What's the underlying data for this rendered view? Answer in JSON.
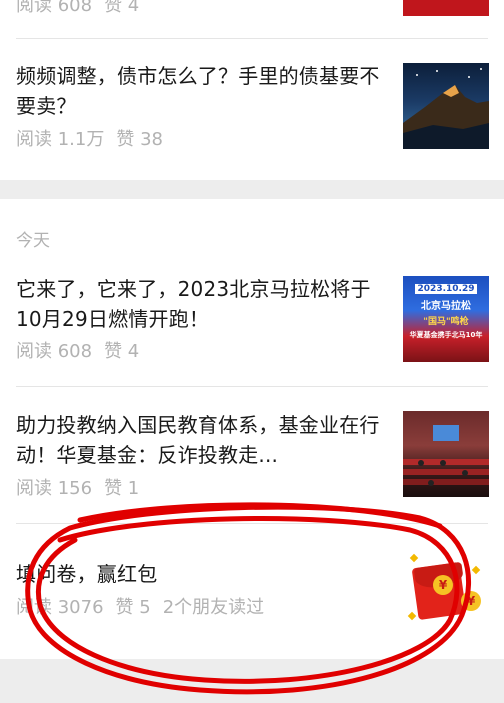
{
  "articles_prev": [
    {
      "title": "",
      "stats": {
        "reads": "阅读 608",
        "likes": "赞 4"
      }
    },
    {
      "title": "频频调整，债市怎么了？手里的债基要不要卖？",
      "stats": {
        "reads": "阅读 1.1万",
        "likes": "赞 38"
      }
    }
  ],
  "section_today": {
    "date_label": "今天",
    "articles": [
      {
        "title": "它来了，它来了，2023北京马拉松将于10月29日燃情开跑！",
        "stats": {
          "reads": "阅读 608",
          "likes": "赞 4"
        },
        "thumb": {
          "line1": "2023.10.29",
          "line2": "北京马拉松",
          "line3": "\"国马\"鸣枪",
          "line4": "华夏基金携手北马10年"
        }
      },
      {
        "title": "助力投教纳入国民教育体系，基金业在行动！华夏基金：反诈投教走...",
        "stats": {
          "reads": "阅读 156",
          "likes": "赞 1"
        }
      },
      {
        "title": "填问卷，赢红包",
        "stats": {
          "reads": "阅读 3076",
          "likes": "赞 5",
          "friends": "2个朋友读过"
        },
        "thumb": {
          "coin_symbol": "¥"
        }
      }
    ]
  },
  "colors": {
    "annotation_red": "#e00000",
    "background": "#ededed",
    "title_text": "#191919",
    "meta_text": "#b2b2b2"
  }
}
